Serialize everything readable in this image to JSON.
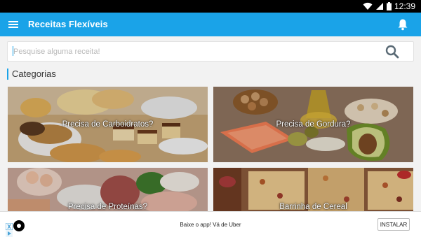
{
  "status_bar": {
    "time": "12:39"
  },
  "app_bar": {
    "title": "Receitas Flexíveis"
  },
  "search": {
    "placeholder": "Pesquise alguma receita!",
    "value": ""
  },
  "section": {
    "title": "Categorias"
  },
  "categories": [
    {
      "label": "Precisa de Carboidratos?"
    },
    {
      "label": "Precisa de Gordura?"
    },
    {
      "label": "Precisa de Proteínas?"
    },
    {
      "label": "Barrinha de Cereal"
    }
  ],
  "ad": {
    "text": "Baixe o app! Vá de Uber",
    "button": "INSTALAR"
  },
  "colors": {
    "accent": "#1aa3e8",
    "status_bar": "#000000"
  }
}
